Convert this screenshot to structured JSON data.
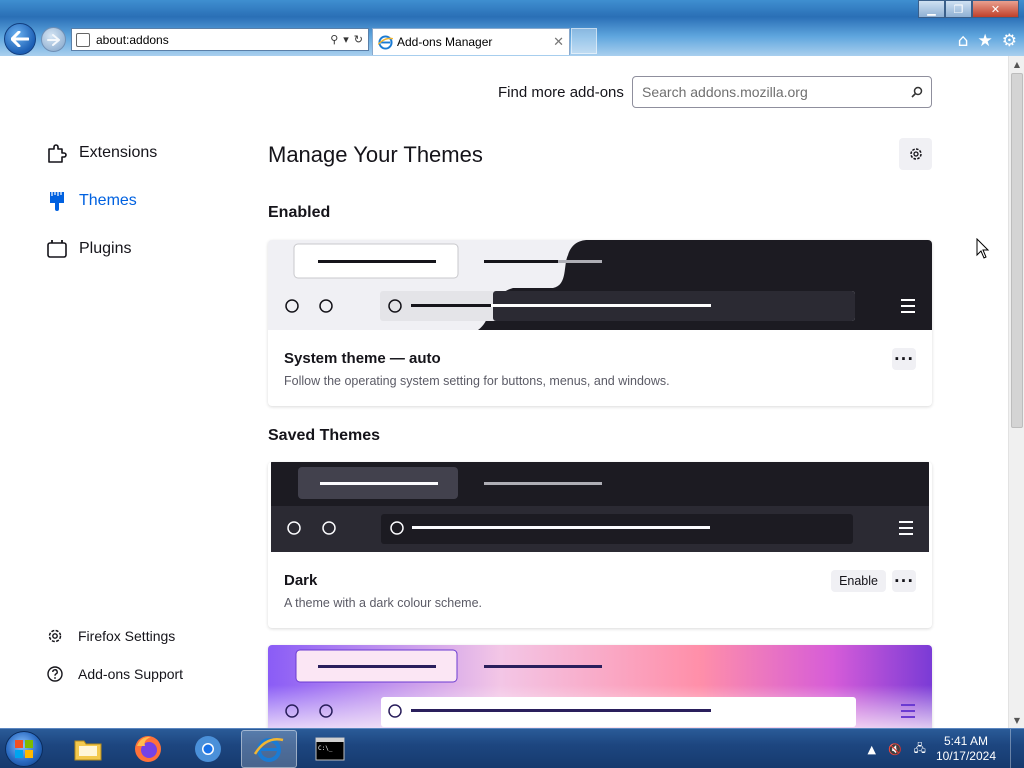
{
  "browser": {
    "address": "about:addons",
    "tab_title": "Add-ons Manager",
    "tab_close": "✕"
  },
  "find_more": {
    "label": "Find more add-ons",
    "placeholder": "Search addons.mozilla.org"
  },
  "sidebar": {
    "items": [
      {
        "label": "Extensions",
        "icon": "puzzle-icon"
      },
      {
        "label": "Themes",
        "icon": "brush-icon",
        "active": true
      },
      {
        "label": "Plugins",
        "icon": "plugin-icon"
      }
    ],
    "footer": [
      {
        "label": "Firefox Settings",
        "icon": "gear-icon"
      },
      {
        "label": "Add-ons Support",
        "icon": "help-icon"
      }
    ]
  },
  "main": {
    "heading": "Manage Your Themes",
    "enabled_heading": "Enabled",
    "saved_heading": "Saved Themes",
    "enabled_theme": {
      "name": "System theme — auto",
      "description": "Follow the operating system setting for buttons, menus, and windows.",
      "more_label": "···"
    },
    "saved_themes": [
      {
        "name": "Dark",
        "description": "A theme with a dark colour scheme.",
        "enable_label": "Enable",
        "more_label": "···"
      }
    ]
  },
  "taskbar": {
    "time": "5:41 AM",
    "date": "10/17/2024",
    "apps": [
      "file-explorer-icon",
      "firefox-icon",
      "chrome-icon",
      "internet-explorer-icon",
      "cmd-icon"
    ]
  },
  "colors": {
    "accent": "#0061e0",
    "dark_theme_bg": "#1c1b22",
    "text": "#15141a"
  }
}
